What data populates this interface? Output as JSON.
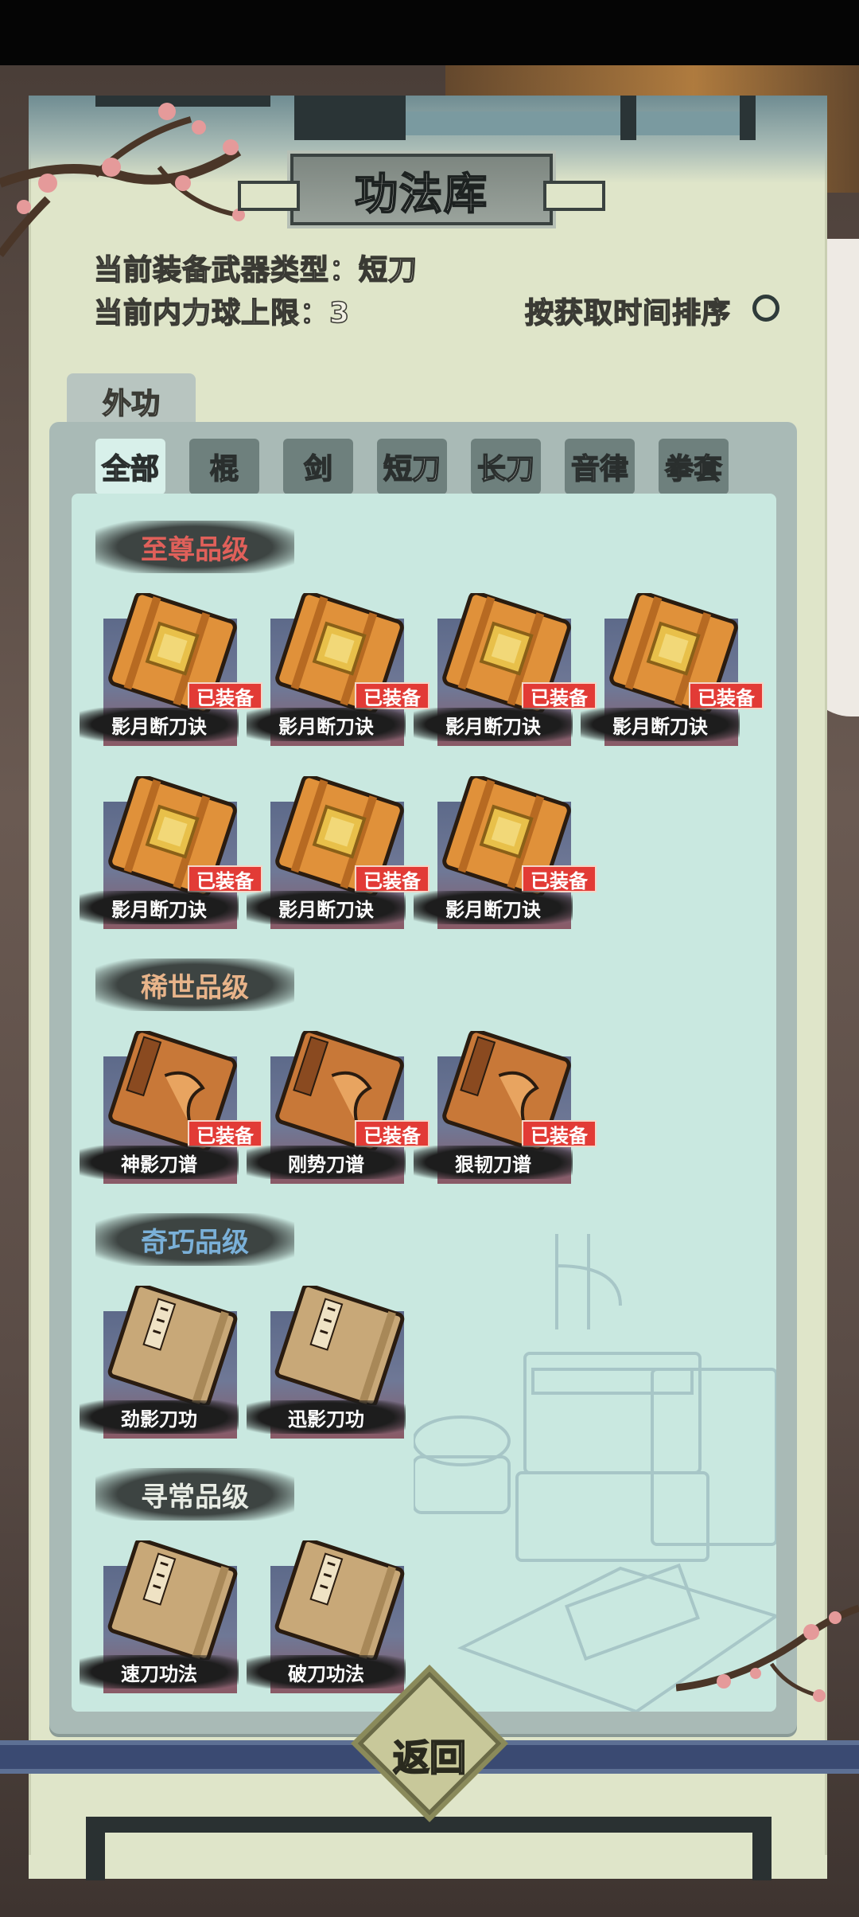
{
  "title": "功法库",
  "info": {
    "weapon_type": "当前装备武器类型：短刀",
    "inner_power_limit": "当前内力球上限：3",
    "sort_label": "按获取时间排序"
  },
  "category_tab": "外功",
  "filters": [
    "全部",
    "棍",
    "剑",
    "短刀",
    "长刀",
    "音律",
    "拳套"
  ],
  "active_filter": "全部",
  "sections": [
    {
      "tier": "至尊品级",
      "color": "#e0605a",
      "items": [
        {
          "name": "影月断刀诀",
          "equipped": "已装备"
        },
        {
          "name": "影月断刀诀",
          "equipped": "已装备"
        },
        {
          "name": "影月断刀诀",
          "equipped": "已装备"
        },
        {
          "name": "影月断刀诀",
          "equipped": "已装备"
        },
        {
          "name": "影月断刀诀",
          "equipped": "已装备"
        },
        {
          "name": "影月断刀诀",
          "equipped": "已装备"
        },
        {
          "name": "影月断刀诀",
          "equipped": "已装备"
        }
      ]
    },
    {
      "tier": "稀世品级",
      "color": "#e8b48a",
      "items": [
        {
          "name": "神影刀谱",
          "equipped": "已装备"
        },
        {
          "name": "刚势刀谱",
          "equipped": "已装备"
        },
        {
          "name": "狠韧刀谱",
          "equipped": "已装备"
        }
      ]
    },
    {
      "tier": "奇巧品级",
      "color": "#7ab0d8",
      "items": [
        {
          "name": "劲影刀功",
          "equipped": ""
        },
        {
          "name": "迅影刀功",
          "equipped": ""
        }
      ]
    },
    {
      "tier": "寻常品级",
      "color": "#e8ece4",
      "items": [
        {
          "name": "速刀功法",
          "equipped": ""
        },
        {
          "name": "破刀功法",
          "equipped": ""
        }
      ]
    }
  ],
  "back_button": "返回"
}
